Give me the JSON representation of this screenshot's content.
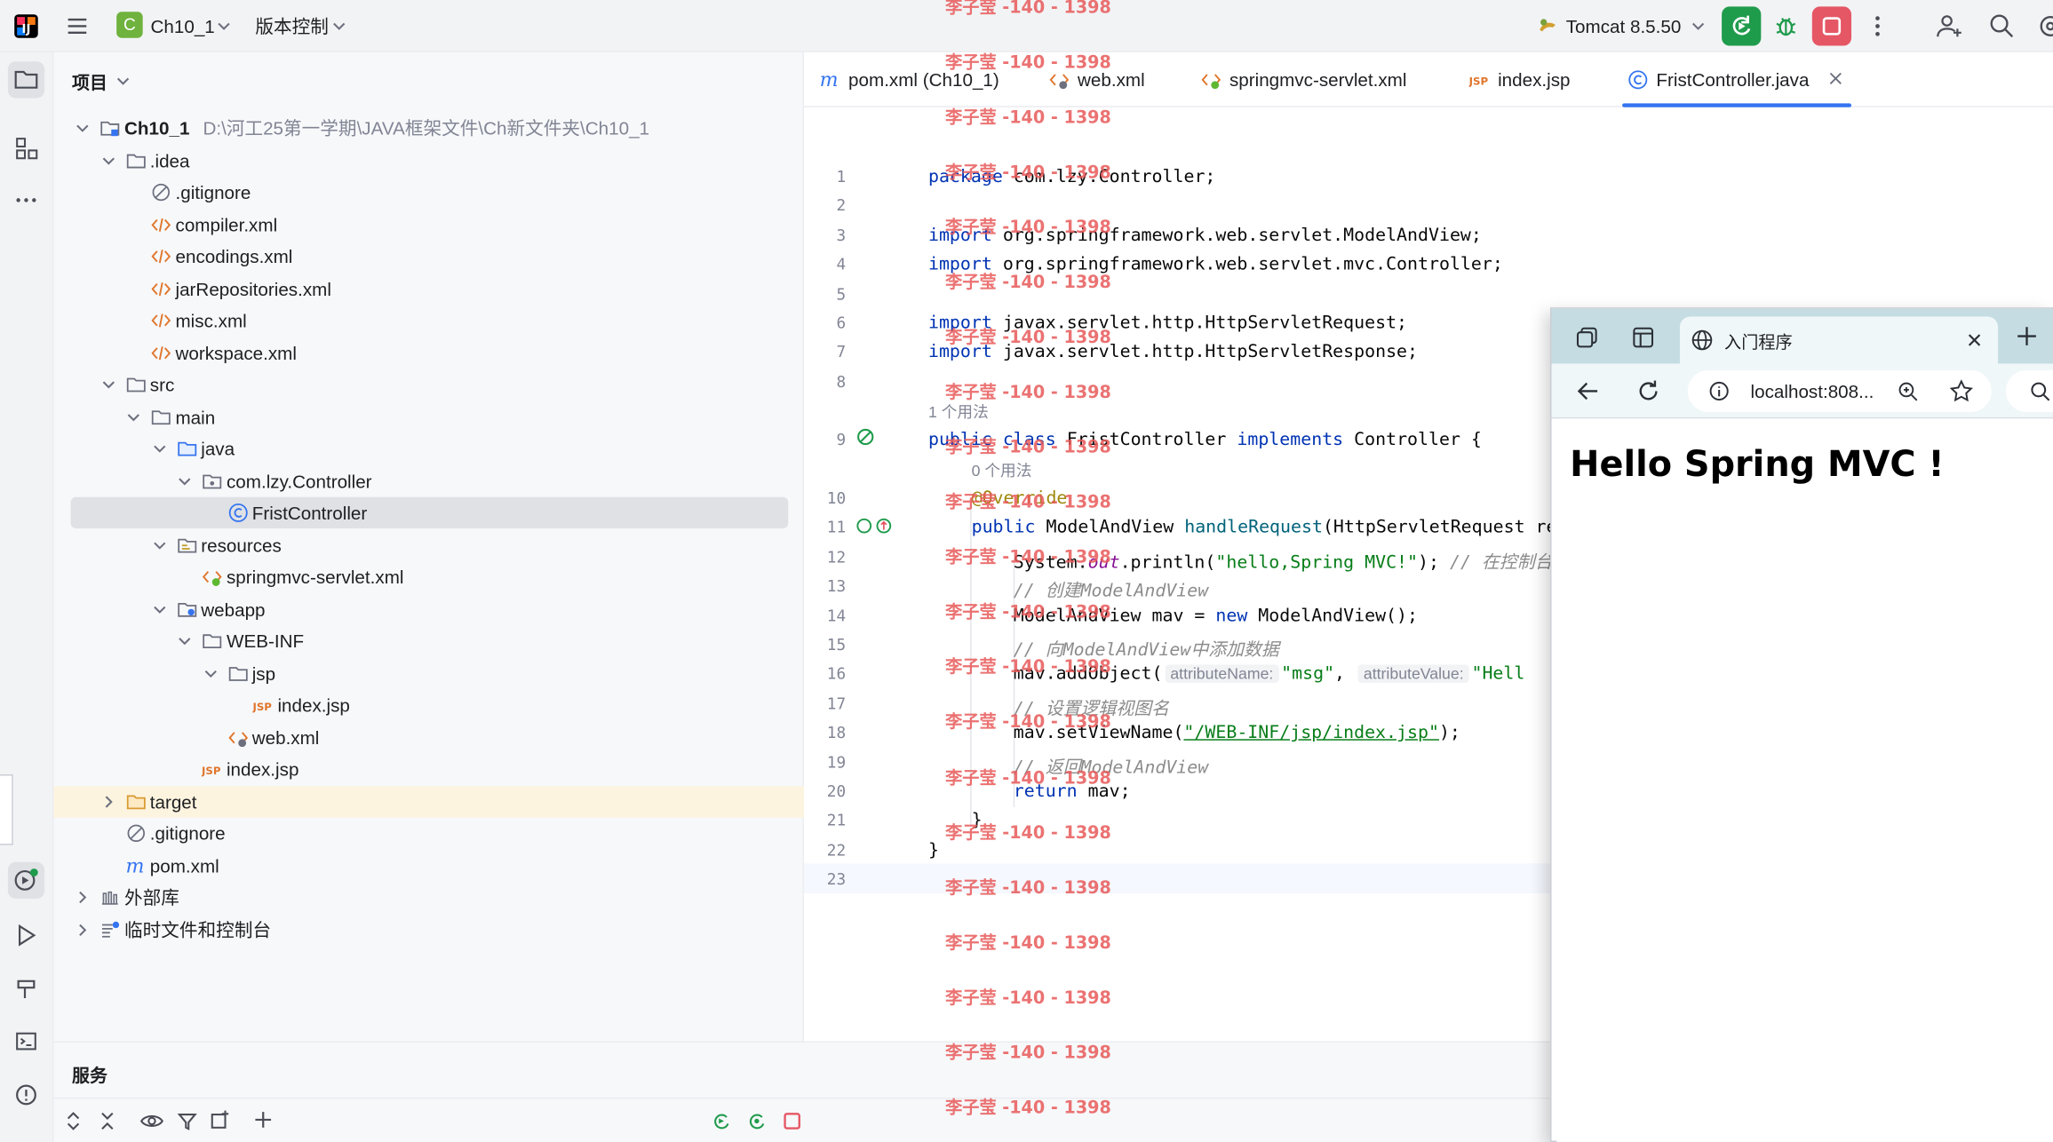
{
  "topbar": {
    "project_badge": "C",
    "project_name": "Ch10_1",
    "vcs_label": "版本控制",
    "run_config": "Tomcat 8.5.50"
  },
  "project_panel": {
    "title": "项目",
    "tree": [
      {
        "label": "Ch10_1",
        "path": "D:\\河工25第一学期\\JAVA框架文件\\Ch新文件夹\\Ch10_1",
        "icon": "module-folder-icon",
        "bold": true
      },
      {
        "label": ".idea",
        "icon": "folder-icon"
      },
      {
        "label": ".gitignore",
        "icon": "ignore-file-icon"
      },
      {
        "label": "compiler.xml",
        "icon": "xml-file-icon"
      },
      {
        "label": "encodings.xml",
        "icon": "xml-file-icon"
      },
      {
        "label": "jarRepositories.xml",
        "icon": "xml-file-icon"
      },
      {
        "label": "misc.xml",
        "icon": "xml-file-icon"
      },
      {
        "label": "workspace.xml",
        "icon": "xml-file-icon"
      },
      {
        "label": "src",
        "icon": "folder-icon"
      },
      {
        "label": "main",
        "icon": "folder-icon"
      },
      {
        "label": "java",
        "icon": "source-folder-icon"
      },
      {
        "label": "com.lzy.Controller",
        "icon": "package-icon"
      },
      {
        "label": "FristController",
        "icon": "class-icon"
      },
      {
        "label": "resources",
        "icon": "resources-folder-icon"
      },
      {
        "label": "springmvc-servlet.xml",
        "icon": "spring-xml-icon"
      },
      {
        "label": "webapp",
        "icon": "web-folder-icon"
      },
      {
        "label": "WEB-INF",
        "icon": "folder-icon"
      },
      {
        "label": "jsp",
        "icon": "folder-icon"
      },
      {
        "label": "index.jsp",
        "icon": "jsp-file-icon"
      },
      {
        "label": "web.xml",
        "icon": "web-xml-icon"
      },
      {
        "label": "index.jsp",
        "icon": "jsp-file-icon"
      },
      {
        "label": "target",
        "icon": "excluded-folder-icon"
      },
      {
        "label": ".gitignore",
        "icon": "ignore-file-icon"
      },
      {
        "label": "pom.xml",
        "icon": "maven-icon"
      },
      {
        "label": "外部库",
        "icon": "library-icon"
      },
      {
        "label": "临时文件和控制台",
        "icon": "scratch-icon"
      }
    ]
  },
  "editor": {
    "tabs": [
      {
        "label": "pom.xml (Ch10_1)",
        "icon": "maven-icon"
      },
      {
        "label": "web.xml",
        "icon": "web-xml-icon"
      },
      {
        "label": "springmvc-servlet.xml",
        "icon": "spring-xml-icon"
      },
      {
        "label": "index.jsp",
        "icon": "jsp-file-icon"
      },
      {
        "label": "FristController.java",
        "icon": "class-icon",
        "active": true
      }
    ],
    "usage_hint_1": "1 个用法",
    "usage_hint_2": "0 个用法",
    "line_numbers": [
      "1",
      "2",
      "3",
      "4",
      "5",
      "6",
      "7",
      "8",
      "9",
      "10",
      "11",
      "12",
      "13",
      "14",
      "15",
      "16",
      "17",
      "18",
      "19",
      "20",
      "21",
      "22",
      "23"
    ],
    "code": {
      "l1_kw": "package",
      "l1_rest": " com.lzy.Controller;",
      "l3_kw": "import",
      "l3_rest": " org.springframework.web.servlet.ModelAndView;",
      "l4_kw": "import",
      "l4_rest": " org.springframework.web.servlet.mvc.Controller;",
      "l6_kw": "import",
      "l6_rest": " javax.servlet.http.HttpServletRequest;",
      "l7_kw": "import",
      "l7_rest": " javax.servlet.http.HttpServletResponse;",
      "l9_kw1": "public class",
      "l9_name": " FristController ",
      "l9_kw2": "implements",
      "l9_rest": " Controller {",
      "l10_ann": "@Override",
      "l11_kw": "public",
      "l11_type": " ModelAndView ",
      "l11_fn": "handleRequest",
      "l11_rest": "(HttpServletRequest re",
      "l12_a": "System.",
      "l12_b": "out",
      "l12_c": ".println(",
      "l12_str": "\"hello,Spring MVC!\"",
      "l12_d": "); ",
      "l12_cmt": "// 在控制台",
      "l13_cmt": "// 创建ModelAndView",
      "l14_a": "ModelAndView mav = ",
      "l14_kw": "new",
      "l14_b": " ModelAndView();",
      "l15_cmt": "// 向ModelAndView中添加数据",
      "l16_a": "mav.addObject(",
      "l16_hint1": "attributeName:",
      "l16_str1": "\"msg\"",
      "l16_b": ", ",
      "l16_hint2": "attributeValue:",
      "l16_str2": "\"Hell",
      "l17_cmt": "// 设置逻辑视图名",
      "l18_a": "mav.setViewName(",
      "l18_str": "\"/WEB-INF/jsp/index.jsp\"",
      "l18_b": ");",
      "l19_cmt": "// 返回ModelAndView",
      "l20_kw": "return",
      "l20_rest": " mav;",
      "l21": "}",
      "l22": "}"
    }
  },
  "watermark": "李子莹 -140 - 1398",
  "services": {
    "title": "服务"
  },
  "browser": {
    "tab_title": "入门程序",
    "address": "localhost:808...",
    "page_heading": "Hello Spring MVC !"
  }
}
